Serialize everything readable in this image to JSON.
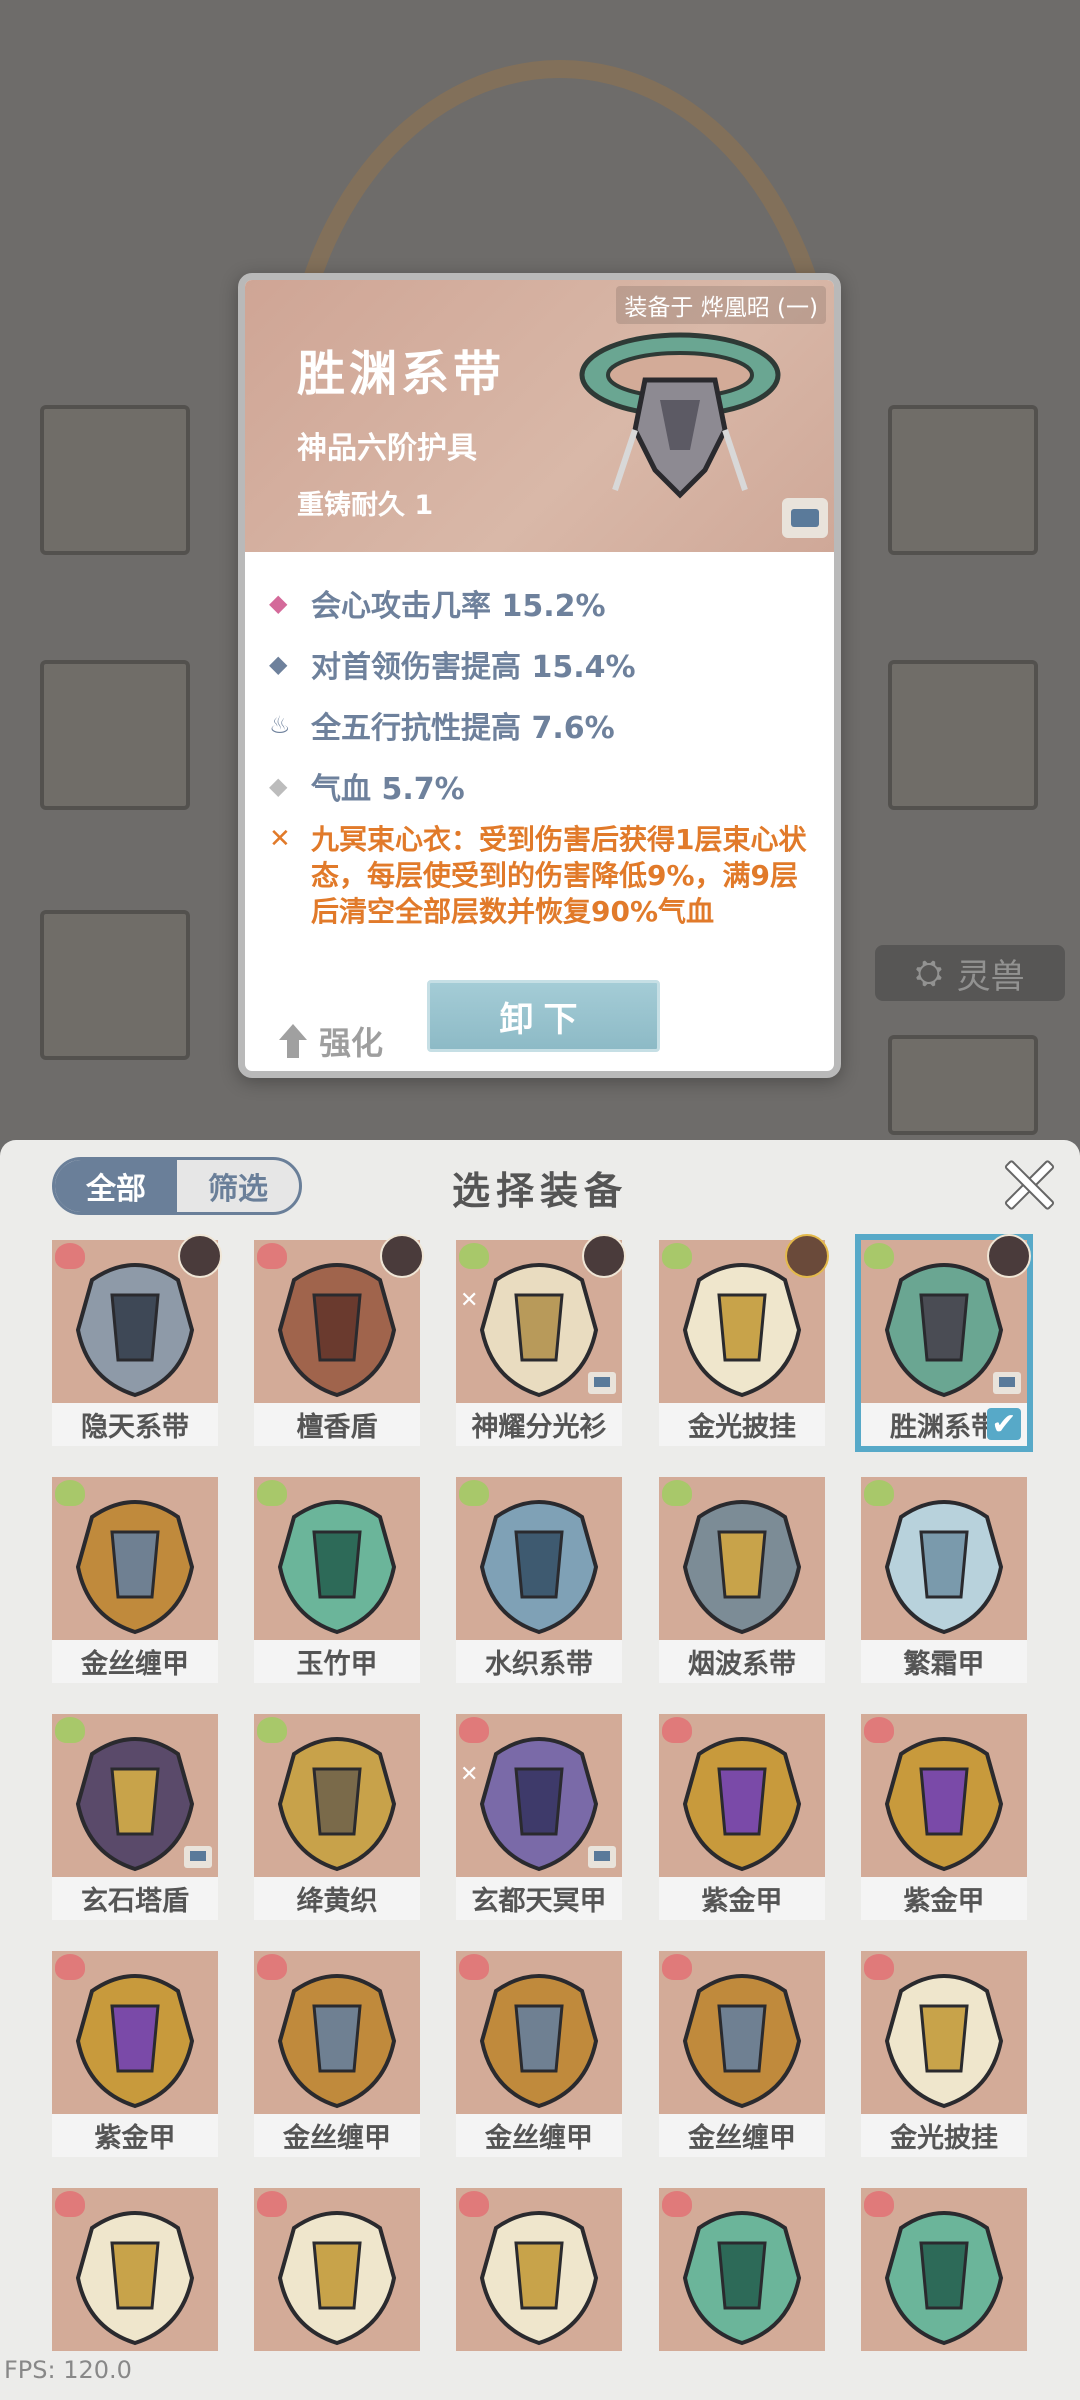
{
  "background": {
    "tab_label": "灵兽"
  },
  "detail": {
    "equipped_on": "装备于 烨凰昭 (一)",
    "name": "胜渊系带",
    "grade": "神品六阶护具",
    "durability": "重铸耐久 1",
    "stats": [
      {
        "icon": "pink-diamond-icon",
        "text": "会心攻击几率 15.2%"
      },
      {
        "icon": "blue-diamond-icon",
        "text": "对首领伤害提高 15.4%"
      },
      {
        "icon": "flame-icon",
        "text": "全五行抗性提高 7.6%"
      },
      {
        "icon": "grey-diamond-icon",
        "text": "气血 5.7%"
      }
    ],
    "special": "九冥束心衣：受到伤害后获得1层束心状态，每层使受到的伤害降低9%，满9层后清空全部层数并恢复90%气血",
    "strengthen_label": "强化",
    "unequip_label": "卸下"
  },
  "panel": {
    "filter_all": "全部",
    "filter_select": "筛选",
    "title": "选择装备"
  },
  "items": [
    {
      "name": "隐天系带",
      "badge": "red",
      "avatar": true
    },
    {
      "name": "檀香盾",
      "badge": "red",
      "avatar": true
    },
    {
      "name": "神耀分光衫",
      "badge": "green",
      "avatar": true,
      "mini": true,
      "swirl": true
    },
    {
      "name": "金光披挂",
      "badge": "green",
      "avatar": true,
      "gold": true
    },
    {
      "name": "胜渊系带",
      "badge": "green",
      "avatar": true,
      "mini": true,
      "selected": true
    },
    {
      "name": "金丝缠甲",
      "badge": "green"
    },
    {
      "name": "玉竹甲",
      "badge": "green"
    },
    {
      "name": "水织系带",
      "badge": "green"
    },
    {
      "name": "烟波系带",
      "badge": "green"
    },
    {
      "name": "繁霜甲",
      "badge": "green"
    },
    {
      "name": "玄石塔盾",
      "badge": "green",
      "mini": true
    },
    {
      "name": "绛黄织",
      "badge": "green"
    },
    {
      "name": "玄都天冥甲",
      "badge": "red",
      "mini": true,
      "swirl": true
    },
    {
      "name": "紫金甲",
      "badge": "red"
    },
    {
      "name": "紫金甲",
      "badge": "red"
    },
    {
      "name": "紫金甲",
      "badge": "red"
    },
    {
      "name": "金丝缠甲",
      "badge": "red"
    },
    {
      "name": "金丝缠甲",
      "badge": "red"
    },
    {
      "name": "金丝缠甲",
      "badge": "red"
    },
    {
      "name": "金光披挂",
      "badge": "red"
    },
    {
      "name": "",
      "badge": "red"
    },
    {
      "name": "",
      "badge": "red"
    },
    {
      "name": "",
      "badge": "red"
    },
    {
      "name": "",
      "badge": "red"
    },
    {
      "name": "",
      "badge": "red"
    }
  ],
  "fps": "FPS: 120.0"
}
